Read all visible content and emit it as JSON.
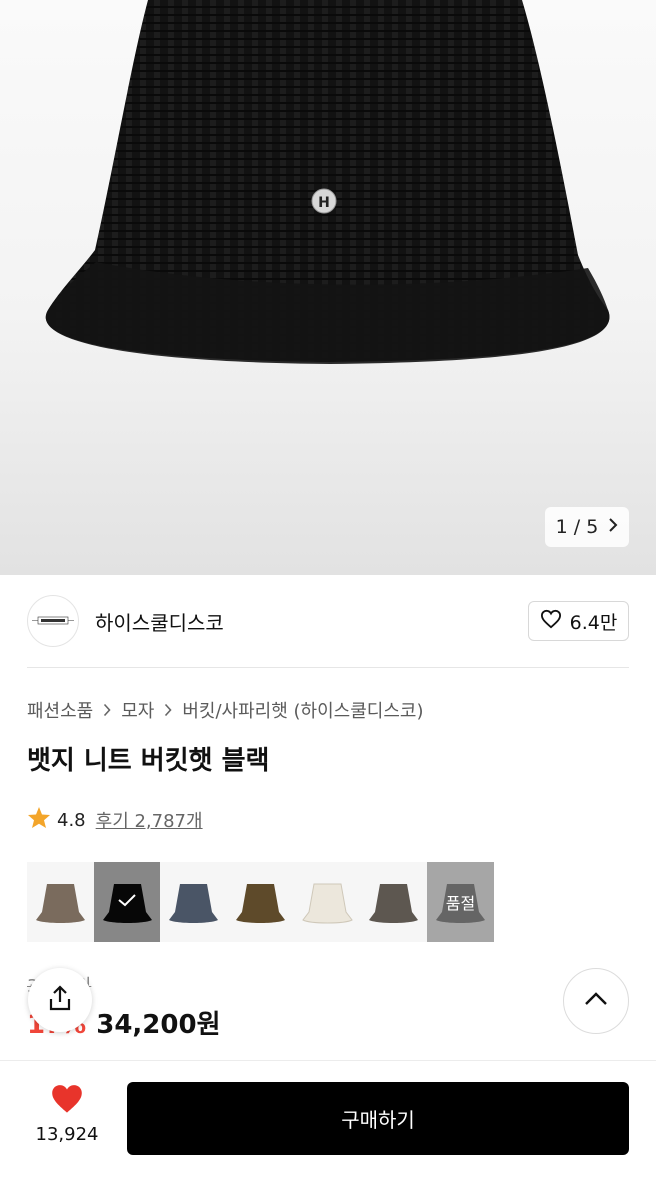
{
  "gallery": {
    "current": "1",
    "total": "5",
    "pager_text": "1 / 5"
  },
  "brand": {
    "name": "하이스쿨디스코",
    "logo_text": "HIGHSCHOOLDISCO",
    "likes": "6.4만"
  },
  "breadcrumb": [
    "패션소품",
    "모자",
    "버킷/사파리햇 (하이스쿨디스코)"
  ],
  "product": {
    "title": "뱃지 니트 버킷햇 블랙",
    "rating": "4.8",
    "reviews_label": "후기 2,787개",
    "original_price": "3?,?0원",
    "discount": "1?%",
    "price": "34,200원"
  },
  "swatches": [
    {
      "color": "#7a6b5d",
      "state": "normal"
    },
    {
      "color": "#0d0d0d",
      "state": "selected"
    },
    {
      "color": "#4a5566",
      "state": "normal"
    },
    {
      "color": "#5e4a2a",
      "state": "normal"
    },
    {
      "color": "#ece7dc",
      "state": "normal"
    },
    {
      "color": "#5d5750",
      "state": "normal"
    },
    {
      "color": "#666666",
      "state": "soldout",
      "label": "품절"
    }
  ],
  "bottom": {
    "wish_count": "13,924",
    "buy_label": "구매하기"
  },
  "colors": {
    "accent_red": "#f0463a",
    "star": "#f3a52a",
    "heart": "#e8342b"
  }
}
